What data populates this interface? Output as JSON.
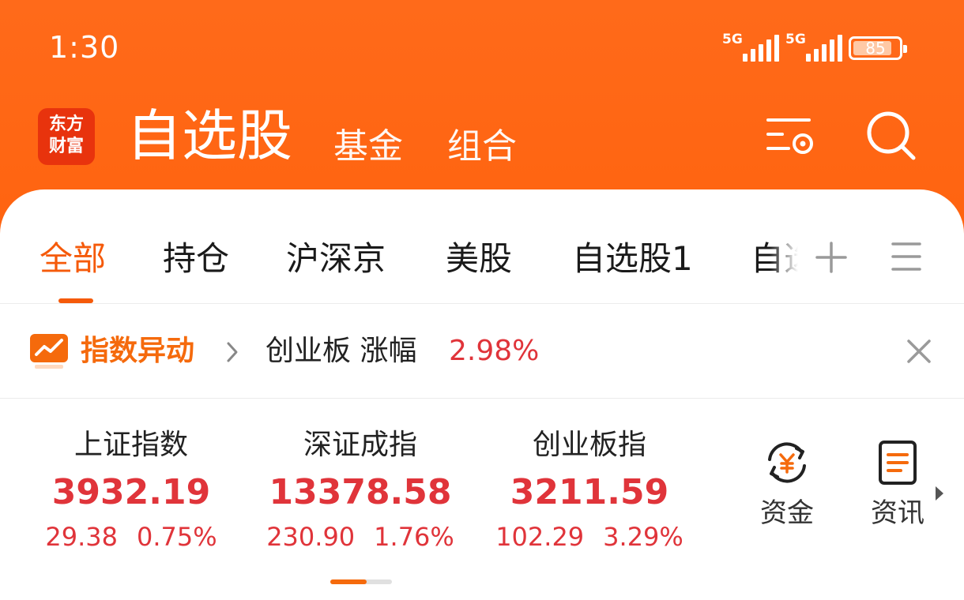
{
  "status": {
    "time": "1:30",
    "signal1": "5G",
    "signal2": "5G",
    "battery": "85",
    "battery_level": 0.85
  },
  "header": {
    "logo_line1": "东方",
    "logo_line2": "财富",
    "title": "自选股",
    "tab_fund": "基金",
    "tab_combo": "组合",
    "settings_icon": "list-settings-icon",
    "search_icon": "search-icon"
  },
  "tabs": {
    "all": "全部",
    "holdings": "持仓",
    "shsz": "沪深京",
    "us": "美股",
    "custom1": "自选股1",
    "custom2": "自选"
  },
  "alert": {
    "title": "指数异动",
    "text": "创业板 涨幅",
    "pct": "2.98%"
  },
  "indices": [
    {
      "name": "上证指数",
      "value": "3932.19",
      "change": "29.38",
      "pct": "0.75%"
    },
    {
      "name": "深证成指",
      "value": "13378.58",
      "change": "230.90",
      "pct": "1.76%"
    },
    {
      "name": "创业板指",
      "value": "3211.59",
      "change": "102.29",
      "pct": "3.29%"
    }
  ],
  "shortcuts": {
    "funds": "资金",
    "news": "资讯"
  },
  "colors": {
    "brand": "#ff5a00",
    "accent": "#f55a0a",
    "up": "#e0343a"
  }
}
